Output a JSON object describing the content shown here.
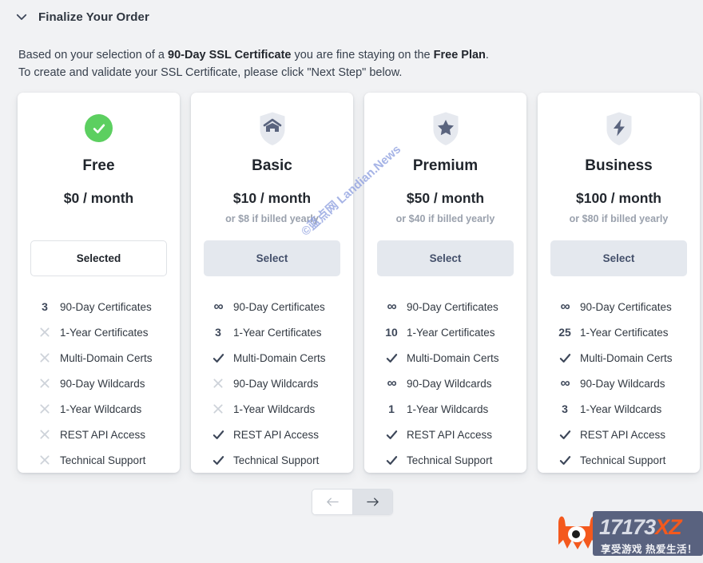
{
  "header": {
    "title": "Finalize Your Order",
    "collapse_icon": "chevron-down-icon"
  },
  "intro": {
    "line1_pre": "Based on your selection of a ",
    "line1_bold": "90-Day SSL Certificate",
    "line1_mid": " you are fine staying on the ",
    "line1_bold2": "Free Plan",
    "line1_post": ".",
    "line2": "To create and validate your SSL Certificate, please click \"Next Step\" below."
  },
  "features_labels": [
    "90-Day Certificates",
    "1-Year Certificates",
    "Multi-Domain Certs",
    "90-Day Wildcards",
    "1-Year Wildcards",
    "REST API Access",
    "Technical Support"
  ],
  "plans": [
    {
      "name": "Free",
      "icon": "green-check-circle-icon",
      "price": "$0 / month",
      "yearly": "",
      "button_label": "Selected",
      "button_state": "selected",
      "marks": [
        "3",
        "cross",
        "cross",
        "cross",
        "cross",
        "cross",
        "cross"
      ]
    },
    {
      "name": "Basic",
      "icon": "shield-home-icon",
      "price": "$10 / month",
      "yearly": "or $8 if billed yearly",
      "button_label": "Select",
      "button_state": "select",
      "marks": [
        "infinity",
        "3",
        "check",
        "cross",
        "cross",
        "check",
        "check"
      ]
    },
    {
      "name": "Premium",
      "icon": "shield-star-icon",
      "price": "$50 / month",
      "yearly": "or $40 if billed yearly",
      "button_label": "Select",
      "button_state": "select",
      "marks": [
        "infinity",
        "10",
        "check",
        "infinity",
        "1",
        "check",
        "check"
      ]
    },
    {
      "name": "Business",
      "icon": "shield-bolt-icon",
      "price": "$100 / month",
      "yearly": "or $80 if billed yearly",
      "button_label": "Select",
      "button_state": "select",
      "marks": [
        "infinity",
        "25",
        "check",
        "infinity",
        "3",
        "check",
        "check"
      ]
    }
  ],
  "pager": {
    "prev_icon": "arrow-left-icon",
    "next_icon": "arrow-right-icon",
    "prev_state": "disabled",
    "next_state": "active"
  },
  "next_step": {
    "label": "Next Step"
  },
  "watermarks": {
    "diagonal_text": "©蓝点网 Landian.News",
    "logo_number": "17173",
    "logo_suffix": "XZ",
    "logo_tagline": "享受游戏 热爱生活！"
  },
  "colors": {
    "page_background": "#f1f2f4",
    "card_background": "#ffffff",
    "accent_green": "#5ccf60",
    "shield_fill": "#e6e9ef",
    "shield_glyph": "#5a647e",
    "select_button_bg": "#e4e8ee",
    "select_button_text": "#44506b",
    "cross_gray": "#cdd2d9",
    "check_navy": "#3d4759",
    "watermark_orange": "#f4591d",
    "watermark_plate": "#59627f"
  }
}
